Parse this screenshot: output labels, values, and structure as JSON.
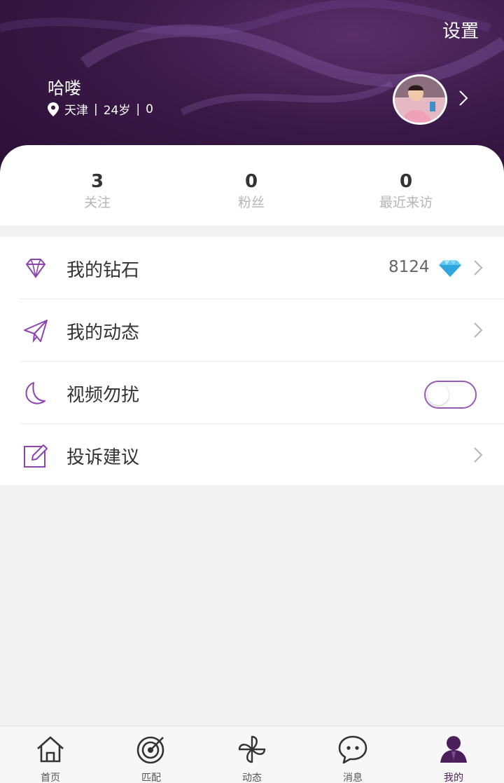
{
  "header": {
    "settings_label": "设置",
    "username": "哈喽",
    "location": "天津",
    "age": "24岁",
    "extra": "0",
    "separator": "|"
  },
  "stats": [
    {
      "value": "3",
      "label": "关注"
    },
    {
      "value": "0",
      "label": "粉丝"
    },
    {
      "value": "0",
      "label": "最近来访"
    }
  ],
  "menu": {
    "diamonds": {
      "label": "我的钻石",
      "count": "8124",
      "icon": "diamond-icon"
    },
    "moments": {
      "label": "我的动态",
      "icon": "paper-plane-icon"
    },
    "dnd": {
      "label": "视频勿扰",
      "icon": "moon-icon",
      "enabled": false
    },
    "feedback": {
      "label": "投诉建议",
      "icon": "edit-icon"
    }
  },
  "tabs": [
    {
      "label": "首页",
      "icon": "home-icon"
    },
    {
      "label": "匹配",
      "icon": "target-icon"
    },
    {
      "label": "动态",
      "icon": "pinwheel-icon"
    },
    {
      "label": "消息",
      "icon": "chat-icon"
    },
    {
      "label": "我的",
      "icon": "user-icon",
      "active": true
    }
  ],
  "colors": {
    "header_dark": "#2a0f35",
    "accent": "#9b59b6",
    "tab_active": "#4a1f5a"
  }
}
